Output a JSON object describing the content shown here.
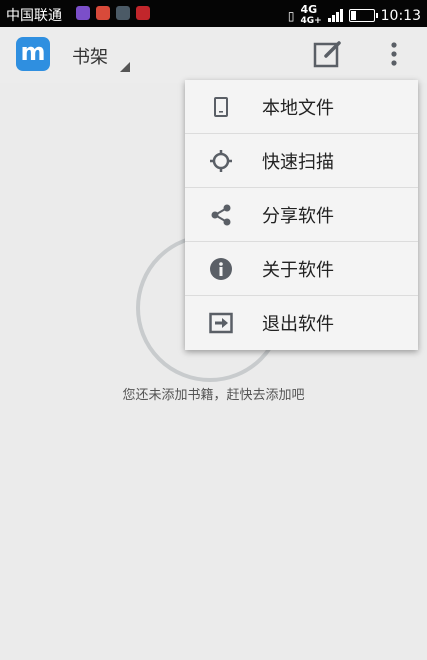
{
  "status_bar": {
    "carrier": "中国联通",
    "network": "4G",
    "network2": "4G+",
    "time": "10:13"
  },
  "app_bar": {
    "title": "书架"
  },
  "menu": {
    "items": [
      {
        "label": "本地文件",
        "icon": "phone-icon"
      },
      {
        "label": "快速扫描",
        "icon": "crosshair-icon"
      },
      {
        "label": "分享软件",
        "icon": "share-icon"
      },
      {
        "label": "关于软件",
        "icon": "info-icon"
      },
      {
        "label": "退出软件",
        "icon": "exit-icon"
      }
    ]
  },
  "empty_state": {
    "message": "您还未添加书籍，赶快去添加吧"
  },
  "colors": {
    "brand": "#2f8fe0",
    "status_bar_bg": "#050505",
    "icon_gray": "#5a5f66"
  }
}
